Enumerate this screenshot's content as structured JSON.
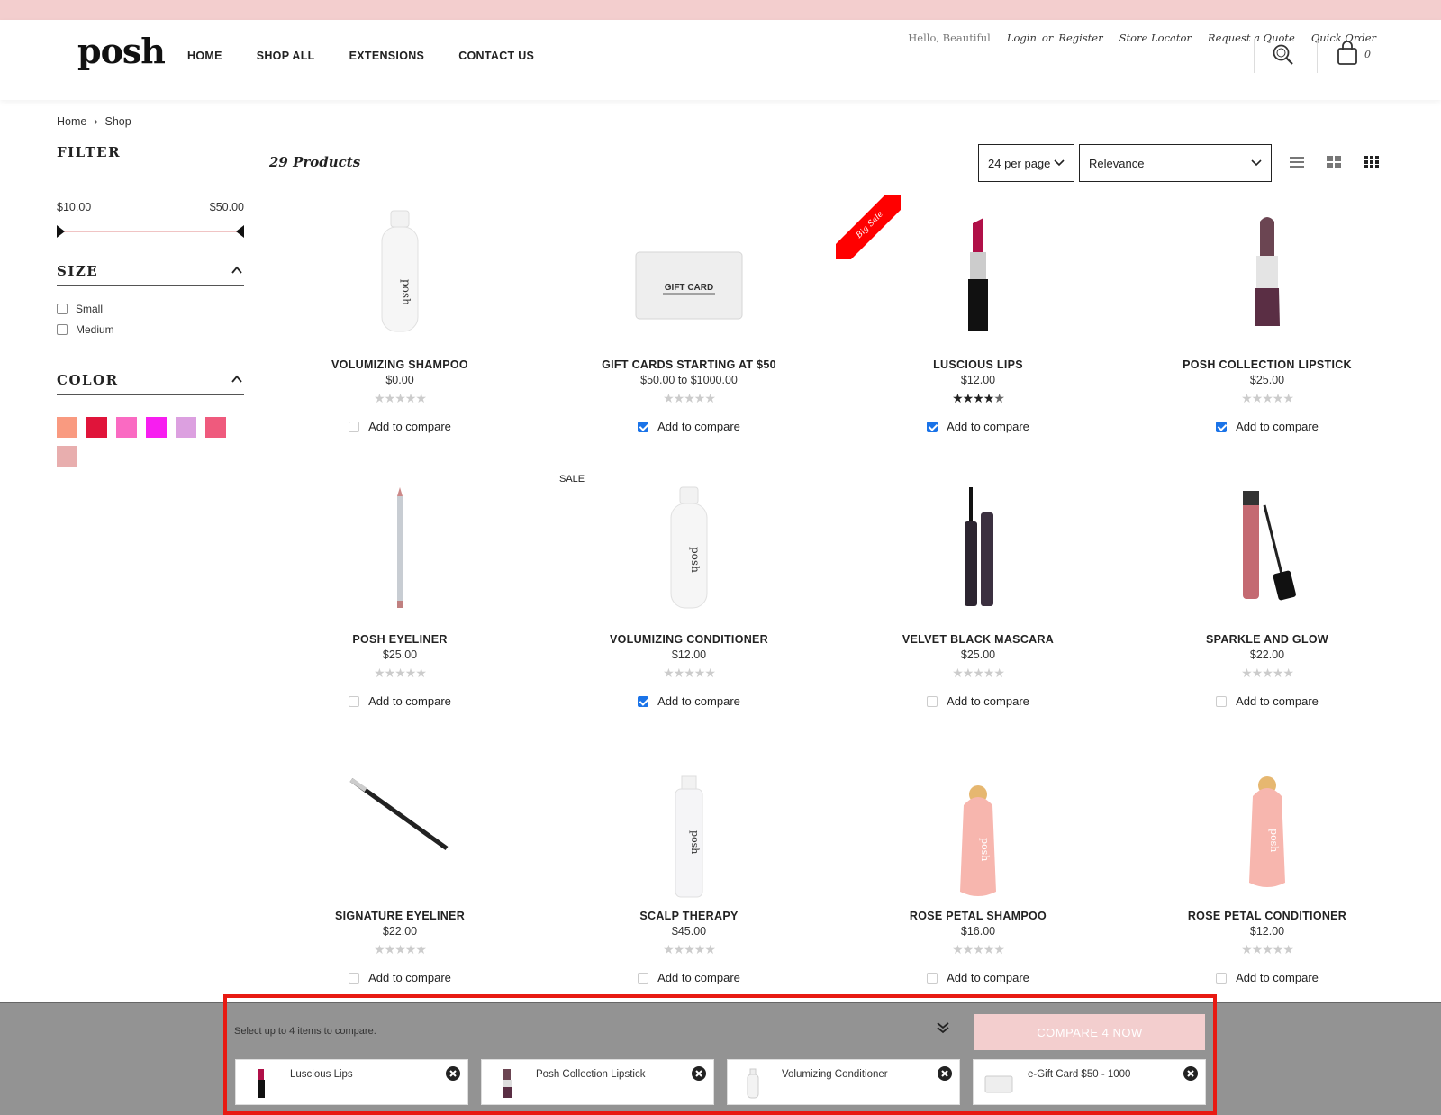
{
  "header": {
    "logo": "posh",
    "greeting": "Hello, Beautiful",
    "login": "Login",
    "or": "or",
    "register": "Register",
    "store_locator": "Store Locator",
    "request_quote": "Request a Quote",
    "quick_order": "Quick Order",
    "nav": [
      "HOME",
      "SHOP ALL",
      "EXTENSIONS",
      "CONTACT US"
    ],
    "cart_count": "0"
  },
  "breadcrumb": {
    "home": "Home",
    "current": "Shop"
  },
  "filter": {
    "title": "FILTER",
    "price_min": "$10.00",
    "price_max": "$50.00",
    "size_title": "SIZE",
    "sizes": [
      "Small",
      "Medium"
    ],
    "color_title": "COLOR",
    "colors": [
      "#f99a80",
      "#e0143a",
      "#fa6ac2",
      "#f71ef0",
      "#dca0e0",
      "#ef5a7d",
      "#e8aeae"
    ]
  },
  "listing": {
    "count": "29 Products",
    "per_page": "24 per page",
    "sort": "Relevance",
    "ribbon": "Big Sale",
    "sale_tag": "SALE",
    "compare_label": "Add to compare",
    "products": [
      {
        "name": "VOLUMIZING SHAMPOO",
        "price": "$0.00",
        "rating": 0,
        "compare": false
      },
      {
        "name": "GIFT CARDS STARTING AT $50",
        "price": "$50.00 to $1000.00",
        "rating": 0,
        "compare": true
      },
      {
        "name": "LUSCIOUS LIPS",
        "price": "$12.00",
        "rating": 4.5,
        "compare": true
      },
      {
        "name": "POSH COLLECTION LIPSTICK",
        "price": "$25.00",
        "rating": 0,
        "compare": true
      },
      {
        "name": "POSH EYELINER",
        "price": "$25.00",
        "rating": 0,
        "compare": false
      },
      {
        "name": "VOLUMIZING CONDITIONER",
        "price": "$12.00",
        "rating": 0,
        "compare": true
      },
      {
        "name": "VELVET BLACK MASCARA",
        "price": "$25.00",
        "rating": 0,
        "compare": false
      },
      {
        "name": "SPARKLE AND GLOW",
        "price": "$22.00",
        "rating": 0,
        "compare": false
      },
      {
        "name": "SIGNATURE EYELINER",
        "price": "$22.00",
        "rating": 0,
        "compare": false
      },
      {
        "name": "SCALP THERAPY",
        "price": "$45.00",
        "rating": 0,
        "compare": false
      },
      {
        "name": "ROSE PETAL SHAMPOO",
        "price": "$16.00",
        "rating": 0,
        "compare": false
      },
      {
        "name": "ROSE PETAL CONDITIONER",
        "price": "$12.00",
        "rating": 0,
        "compare": false
      }
    ]
  },
  "compare_bar": {
    "hint": "Select up to 4 items to compare.",
    "button": "COMPARE 4 NOW",
    "items": [
      "Luscious Lips",
      "Posh Collection Lipstick",
      "Volumizing Conditioner",
      "e-Gift Card $50 - 1000"
    ]
  },
  "colors": {
    "accent_pink": "#f3cece",
    "highlight_red": "#e81a12",
    "compare_bar": "#939393"
  }
}
